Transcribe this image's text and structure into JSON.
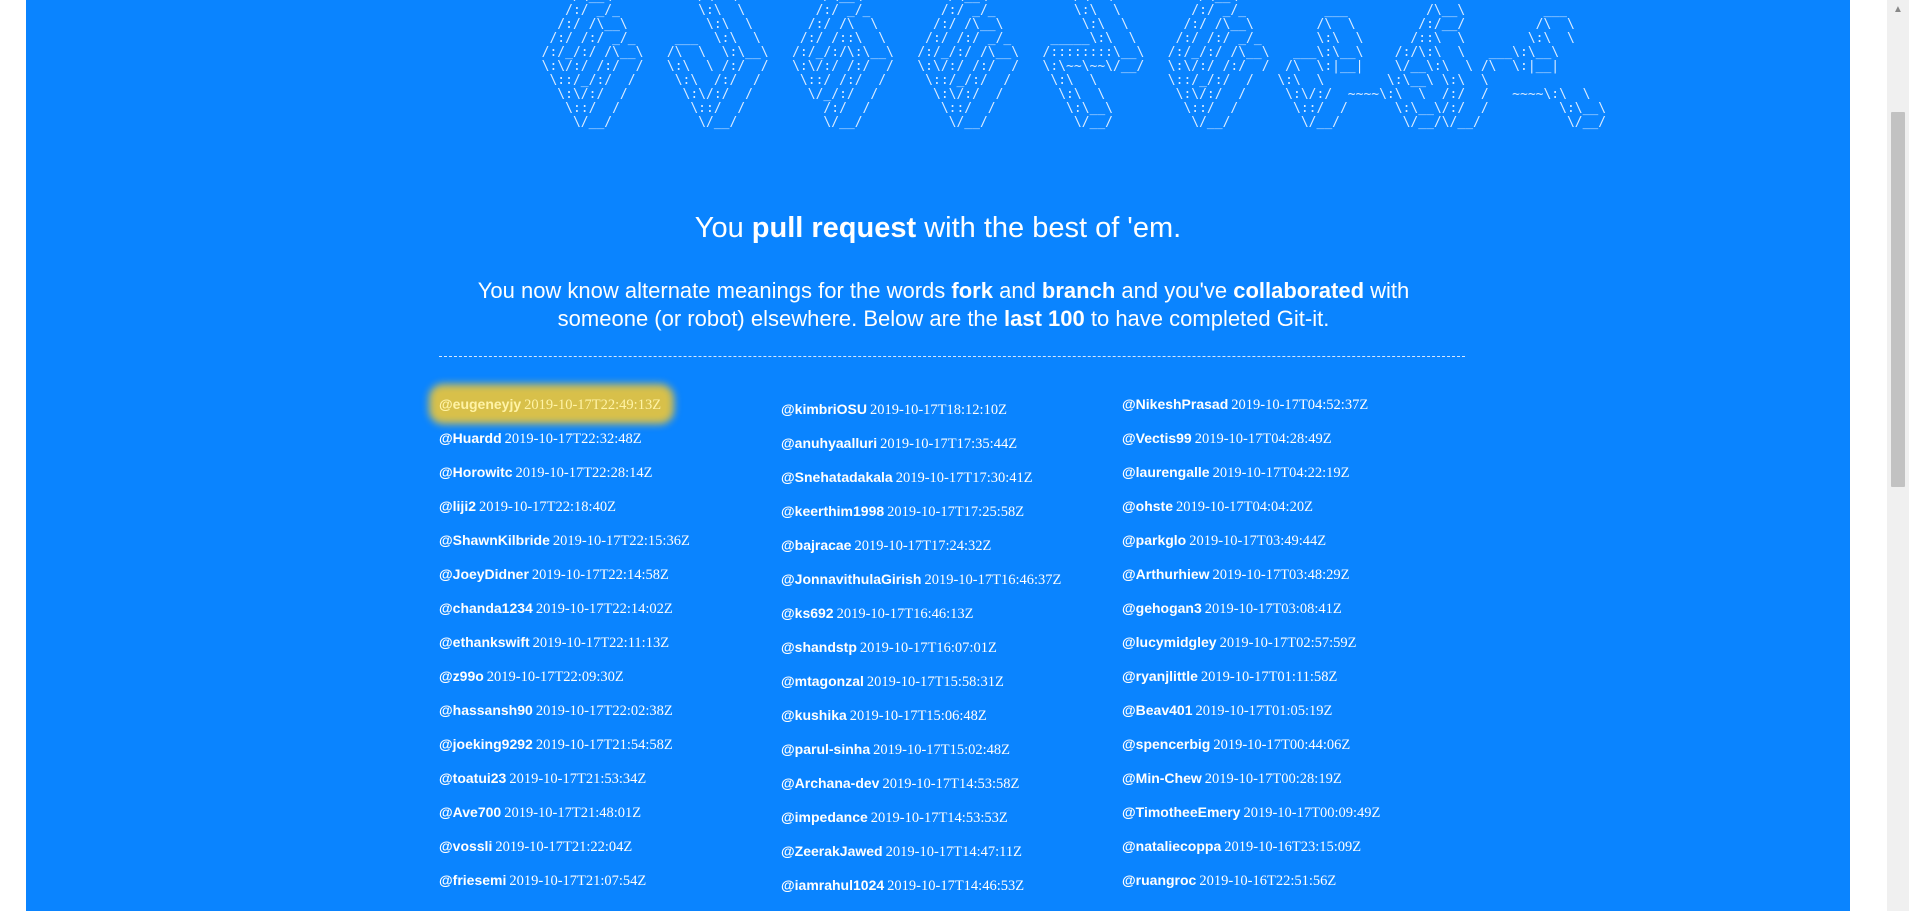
{
  "ascii_banner": "      /\\__\\           /\\  \\           /\\__\\           /\\__\\           /\\  \\           /\\__\\\n     /:/ _/_          \\:\\  \\         /:/ _/_         /:/ _/_          \\:\\  \\         /:/ _/_          ___          /\\__\\          ___\n    /:/ /\\__\\          \\:\\  \\       /:/ /\\  \\       /:/ /\\__\\          \\:\\  \\       /:/ /\\__\\        /\\  \\        /:/__/         /\\  \\\n   /:/ /:/ _/_     ___  \\:\\  \\     /:/ /::\\  \\     /:/ /:/ _/_     _____\\:\\  \\     /:/ /:/ _/_       \\:\\  \\      /::\\  \\        \\:\\  \\\n  /:/_/:/ /\\__\\   /\\  \\  \\:\\__\\   /:/_/:/\\:\\__\\   /:/_/:/ /\\__\\   /::::::::\\__\\   /:/_/:/ /\\__\\   ___\\:\\__\\    /:/\\:\\  \\   ___\\:\\__\\\n  \\:\\/:/ /:/  /   \\:\\  \\ /:/  /   \\:\\/:/ /:/  /   \\:\\/:/ /:/  /   \\:\\~~\\~~\\/__/   \\:\\/:/ /:/  /  /\\  \\:|__|    \\/__\\:\\  \\ /\\  \\:|__|\n   \\::/_/:/  /     \\:\\  /:/  /     \\::/ /:/  /     \\::/_/:/  /     \\:\\  \\         \\::/_/:/  /   \\:\\  \\        \\:\\__\\ \\:\\  \\\n    \\:\\/:/  /       \\:\\/:/  /       \\/_/:/  /       \\:\\/:/  /       \\:\\  \\         \\:\\/:/  /     \\:\\/:/  ~~~~\\:\\  \\  /:/  /   ~~~~\\:\\  \\\n     \\::/  /         \\::/  /          /:/  /         \\::/  /         \\:\\__\\         \\::/  /       \\::/  /      \\:\\__\\/:/  /         \\:\\__\\\n      \\/__/           \\/__/           \\/__/           \\/__/           \\/__/          \\/__/         \\/__/        \\/__/\\/__/           \\/__/",
  "tagline": {
    "pre": "You ",
    "bold": "pull request",
    "post": " with the best of 'em."
  },
  "intro": {
    "t1": "You now know alternate meanings for the words ",
    "b1": "fork",
    "t2": " and ",
    "b2": "branch",
    "t3": " and you've ",
    "b3": "collaborated",
    "t4": " with someone (or robot) elsewhere. Below are the ",
    "b4": "last 100",
    "t5": " to have completed Git-it."
  },
  "columns": [
    [
      {
        "user": "@eugeneyjy",
        "ts": "2019-10-17T22:49:13Z"
      },
      {
        "user": "@Huardd",
        "ts": "2019-10-17T22:32:48Z"
      },
      {
        "user": "@Horowitc",
        "ts": "2019-10-17T22:28:14Z"
      },
      {
        "user": "@liji2",
        "ts": "2019-10-17T22:18:40Z"
      },
      {
        "user": "@ShawnKilbride",
        "ts": "2019-10-17T22:15:36Z"
      },
      {
        "user": "@JoeyDidner",
        "ts": "2019-10-17T22:14:58Z"
      },
      {
        "user": "@chanda1234",
        "ts": "2019-10-17T22:14:02Z"
      },
      {
        "user": "@ethankswift",
        "ts": "2019-10-17T22:11:13Z"
      },
      {
        "user": "@z99o",
        "ts": "2019-10-17T22:09:30Z"
      },
      {
        "user": "@hassansh90",
        "ts": "2019-10-17T22:02:38Z"
      },
      {
        "user": "@joeking9292",
        "ts": "2019-10-17T21:54:58Z"
      },
      {
        "user": "@toatui23",
        "ts": "2019-10-17T21:53:34Z"
      },
      {
        "user": "@Ave700",
        "ts": "2019-10-17T21:48:01Z"
      },
      {
        "user": "@vossli",
        "ts": "2019-10-17T21:22:04Z"
      },
      {
        "user": "@friesemi",
        "ts": "2019-10-17T21:07:54Z"
      }
    ],
    [
      {
        "user": "@kimbriOSU",
        "ts": "2019-10-17T18:12:10Z"
      },
      {
        "user": "@anuhyaalluri",
        "ts": "2019-10-17T17:35:44Z"
      },
      {
        "user": "@Snehatadakala",
        "ts": "2019-10-17T17:30:41Z"
      },
      {
        "user": "@keerthim1998",
        "ts": "2019-10-17T17:25:58Z"
      },
      {
        "user": "@bajracae",
        "ts": "2019-10-17T17:24:32Z"
      },
      {
        "user": "@JonnavithulaGirish",
        "ts": "2019-10-17T16:46:37Z"
      },
      {
        "user": "@ks692",
        "ts": "2019-10-17T16:46:13Z"
      },
      {
        "user": "@shandstp",
        "ts": "2019-10-17T16:07:01Z"
      },
      {
        "user": "@mtagonzal",
        "ts": "2019-10-17T15:58:31Z"
      },
      {
        "user": "@kushika",
        "ts": "2019-10-17T15:06:48Z"
      },
      {
        "user": "@parul-sinha",
        "ts": "2019-10-17T15:02:48Z"
      },
      {
        "user": "@Archana-dev",
        "ts": "2019-10-17T14:53:58Z"
      },
      {
        "user": "@impedance",
        "ts": "2019-10-17T14:53:53Z"
      },
      {
        "user": "@ZeerakJawed",
        "ts": "2019-10-17T14:47:11Z"
      },
      {
        "user": "@iamrahul1024",
        "ts": "2019-10-17T14:46:53Z"
      }
    ],
    [
      {
        "user": "@NikeshPrasad",
        "ts": "2019-10-17T04:52:37Z"
      },
      {
        "user": "@Vectis99",
        "ts": "2019-10-17T04:28:49Z"
      },
      {
        "user": "@laurengalle",
        "ts": "2019-10-17T04:22:19Z"
      },
      {
        "user": "@ohste",
        "ts": "2019-10-17T04:04:20Z"
      },
      {
        "user": "@parkglo",
        "ts": "2019-10-17T03:49:44Z"
      },
      {
        "user": "@Arthurhiew",
        "ts": "2019-10-17T03:48:29Z"
      },
      {
        "user": "@gehogan3",
        "ts": "2019-10-17T03:08:41Z"
      },
      {
        "user": "@lucymidgley",
        "ts": "2019-10-17T02:57:59Z"
      },
      {
        "user": "@ryanjlittle",
        "ts": "2019-10-17T01:11:58Z"
      },
      {
        "user": "@Beav401",
        "ts": "2019-10-17T01:05:19Z"
      },
      {
        "user": "@spencerbig",
        "ts": "2019-10-17T00:44:06Z"
      },
      {
        "user": "@Min-Chew",
        "ts": "2019-10-17T00:28:19Z"
      },
      {
        "user": "@TimotheeEmery",
        "ts": "2019-10-17T00:09:49Z"
      },
      {
        "user": "@nataliecoppa",
        "ts": "2019-10-16T23:15:09Z"
      },
      {
        "user": "@ruangroc",
        "ts": "2019-10-16T22:51:56Z"
      }
    ]
  ],
  "colors": {
    "background": "#0a84ff",
    "highlight": "#d8c04a"
  }
}
